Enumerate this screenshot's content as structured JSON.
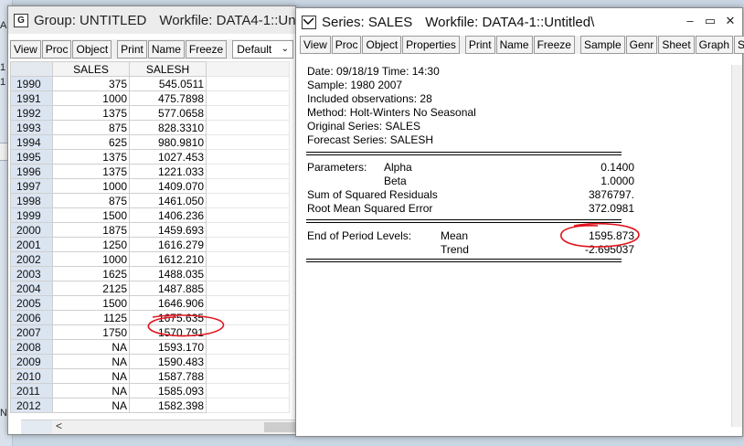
{
  "background": {
    "fragments": [
      "A",
      "1",
      "1",
      "N"
    ]
  },
  "group_window": {
    "badge": "G",
    "title": "Group: UNTITLED",
    "workfile": "Workfile: DATA4-1::Unti",
    "toolbar": [
      "View",
      "Proc",
      "Object",
      "Print",
      "Name",
      "Freeze"
    ],
    "select_value": "Default",
    "columns": [
      "",
      "SALES",
      "SALESH"
    ],
    "rows": [
      [
        "1990",
        "375",
        "545.0511"
      ],
      [
        "1991",
        "1000",
        "475.7898"
      ],
      [
        "1992",
        "1375",
        "577.0658"
      ],
      [
        "1993",
        "875",
        "828.3310"
      ],
      [
        "1994",
        "625",
        "980.9810"
      ],
      [
        "1995",
        "1375",
        "1027.453"
      ],
      [
        "1996",
        "1375",
        "1221.033"
      ],
      [
        "1997",
        "1000",
        "1409.070"
      ],
      [
        "1998",
        "875",
        "1461.050"
      ],
      [
        "1999",
        "1500",
        "1406.236"
      ],
      [
        "2000",
        "1875",
        "1459.693"
      ],
      [
        "2001",
        "1250",
        "1616.279"
      ],
      [
        "2002",
        "1000",
        "1612.210"
      ],
      [
        "2003",
        "1625",
        "1488.035"
      ],
      [
        "2004",
        "2125",
        "1487.885"
      ],
      [
        "2005",
        "1500",
        "1646.906"
      ],
      [
        "2006",
        "1125",
        "1675.635"
      ],
      [
        "2007",
        "1750",
        "1570.791"
      ],
      [
        "2008",
        "NA",
        "1593.170"
      ],
      [
        "2009",
        "NA",
        "1590.483"
      ],
      [
        "2010",
        "NA",
        "1587.788"
      ],
      [
        "2011",
        "NA",
        "1585.093"
      ],
      [
        "2012",
        "NA",
        "1582.398"
      ]
    ],
    "scroll_arrow": "<"
  },
  "series_window": {
    "title": "Series: SALES",
    "workfile": "Workfile: DATA4-1::Untitled\\",
    "window_buttons": [
      "–",
      "▭",
      "✕"
    ],
    "toolbar": [
      "View",
      "Proc",
      "Object",
      "Properties",
      "Print",
      "Name",
      "Freeze",
      "Sample",
      "Genr",
      "Sheet",
      "Graph",
      "Stats",
      "I"
    ],
    "header_lines": [
      "Date: 09/18/19   Time: 14:30",
      "Sample: 1980 2007",
      "Included observations: 28",
      "Method: Holt-Winters No Seasonal",
      "Original Series: SALES",
      "Forecast Series: SALESH"
    ],
    "parameters_label": "Parameters:",
    "alpha_label": "Alpha",
    "alpha_value": "0.1400",
    "beta_label": "Beta",
    "beta_value": "1.0000",
    "ssr_label": "Sum of Squared Residuals",
    "ssr_value": "3876797.",
    "rmse_label": "Root Mean Squared Error",
    "rmse_value": "372.0981",
    "levels_label": "End of Period Levels:",
    "mean_label": "Mean",
    "mean_value": "1595.873",
    "trend_label": "Trend",
    "trend_value": "-2.695037"
  },
  "colors": {
    "row_header_bg": "#dbe5f1",
    "annotation_red": "#e0141e"
  }
}
